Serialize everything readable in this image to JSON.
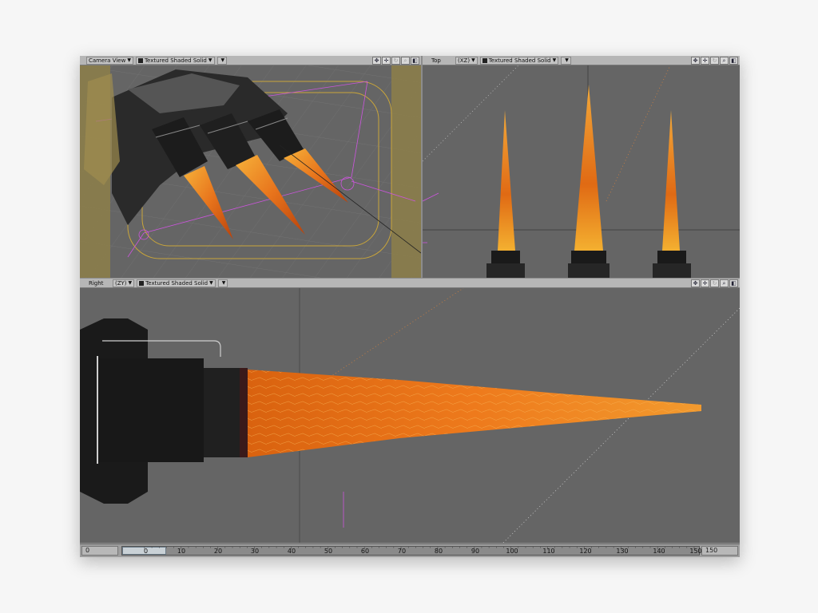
{
  "viewports": {
    "camera": {
      "view": "Camera View",
      "shading": "Textured Shaded Solid"
    },
    "top": {
      "view": "Top",
      "axes": "(XZ)",
      "shading": "Textured Shaded Solid"
    },
    "right": {
      "view": "Right",
      "axes": "(ZY)",
      "shading": "Textured Shaded Solid"
    }
  },
  "header_icons": [
    "move-icon",
    "pan-icon",
    "rotate-icon",
    "zoom-icon",
    "maximize-icon"
  ],
  "timeline": {
    "start_frame": "0",
    "end_frame": "150",
    "current_frame": "0",
    "tick_labels": [
      "10",
      "20",
      "30",
      "40",
      "50",
      "60",
      "70",
      "80",
      "90",
      "100",
      "110",
      "120",
      "130",
      "140",
      "150"
    ]
  },
  "colors": {
    "viewport_bg": "#656565",
    "flame_orange": "#e8741c",
    "selection_magenta": "#cc55dd",
    "safe_frame_yellow": "#c9a53a"
  }
}
